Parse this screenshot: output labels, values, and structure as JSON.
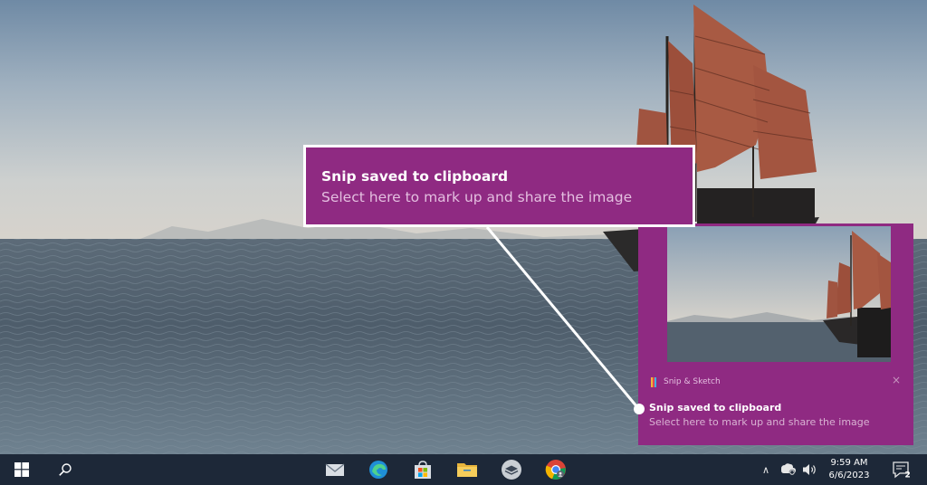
{
  "callout": {
    "title": "Snip saved to clipboard",
    "body": "Select here to mark up and share the image"
  },
  "toast": {
    "app_name": "Snip & Sketch",
    "close_icon": "×",
    "title": "Snip saved to clipboard",
    "body": "Select here to mark up and share the image",
    "accent": "#8f2a82"
  },
  "taskbar": {
    "pinned_icons": [
      "mail-icon",
      "edge-icon",
      "store-icon",
      "file-explorer-icon",
      "layers-icon",
      "chrome-icon"
    ],
    "tray_chevron": "∧",
    "time": "9:59 AM",
    "date": "6/6/2023",
    "notification_count": "2",
    "background": "#1d2838"
  }
}
